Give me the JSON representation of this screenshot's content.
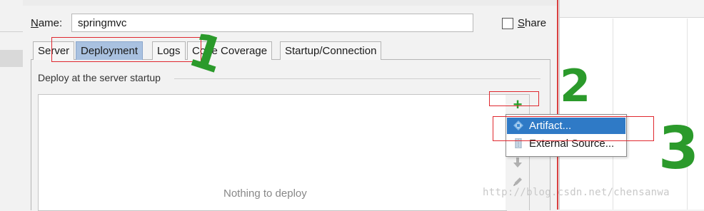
{
  "config": {
    "name_label": "Name:",
    "name_value": "springmvc",
    "share_label": "Share",
    "share_checked": false
  },
  "tabs": [
    {
      "label": "Server",
      "active": false
    },
    {
      "label": "Deployment",
      "active": true
    },
    {
      "label": "Logs",
      "active": false
    },
    {
      "label": "Code Coverage",
      "active": false
    },
    {
      "label": "Startup/Connection",
      "active": false
    }
  ],
  "deployment": {
    "section_label": "Deploy at the server startup",
    "empty_text": "Nothing to deploy",
    "toolbar": {
      "add_icon": "plus-icon",
      "move_down_icon": "arrow-down-icon",
      "edit_icon": "pencil-icon"
    }
  },
  "add_menu": {
    "items": [
      {
        "label": "Artifact...",
        "icon": "artifact-icon",
        "selected": true
      },
      {
        "label": "External Source...",
        "icon": "external-source-icon",
        "selected": false
      }
    ]
  },
  "annotations": {
    "step_1": "1",
    "step_2": "2",
    "step_3": "3",
    "highlight_color": "#e0282f",
    "marker_color": "#2b9a2b"
  },
  "watermark": "http://blog.csdn.net/chensanwa"
}
